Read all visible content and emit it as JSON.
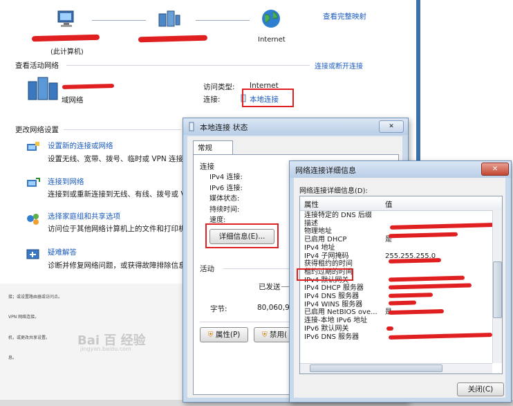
{
  "topbar": {
    "view_full_map": "查看完整映射",
    "this_computer": "(此计算机)",
    "internet_label": "Internet"
  },
  "active_networks": {
    "heading": "查看活动网络",
    "connect_disconnect": "连接或断开连接",
    "network_type": "域网络",
    "access_type_label": "访问类型:",
    "access_type_value": "Internet",
    "connection_label": "连接:",
    "connection_value": "本地连接"
  },
  "change_settings": {
    "heading": "更改网络设置",
    "items": [
      {
        "title": "设置新的连接或网络",
        "desc": "设置无线、宽带、拨号、临时或 VPN 连接"
      },
      {
        "title": "连接到网络",
        "desc": "连接到或重新连接到无线、有线、拨号或 V"
      },
      {
        "title": "选择家庭组和共享选项",
        "desc": "访问位于其他网络计算机上的文件和打印机"
      },
      {
        "title": "疑难解答",
        "desc": "诊断并修复网络问题，或获得故障排除信息"
      }
    ]
  },
  "left_small_text": [
    "接；或设置路由器或访问点。",
    "VPN 网络连接。",
    "机，或更改共享设置。",
    "息。"
  ],
  "watermark": {
    "line1": "Bai 百 经验",
    "line2": "jingyan.baidu.com"
  },
  "status_dialog": {
    "title": "本地连接 状态",
    "close_glyph": "✕",
    "tab": "常规",
    "connection_group": "连接",
    "rows": [
      "IPv4 连接:",
      "IPv6 连接:",
      "媒体状态:",
      "持续时间:",
      "速度:"
    ],
    "details_button": "详细信息(E)...",
    "activity_group": "活动",
    "sent_label": "已发送",
    "bytes_label": "字节:",
    "bytes_value": "80,060,9",
    "properties_button": "属性(P)",
    "disable_button": "禁用("
  },
  "details_dialog": {
    "title": "网络连接详细信息",
    "close_glyph": "✕",
    "subtitle": "网络连接详细信息(D):",
    "col_property": "属性",
    "col_value": "值",
    "rows": [
      {
        "property": "连接特定的 DNS 后缀",
        "value": ""
      },
      {
        "property": "描述",
        "value": ""
      },
      {
        "property": "物理地址",
        "value": ""
      },
      {
        "property": "已启用 DHCP",
        "value": "是"
      },
      {
        "property": "IPv4 地址",
        "value": ""
      },
      {
        "property": "IPv4 子网掩码",
        "value": "255.255.255.0"
      },
      {
        "property": "获得租约的时间",
        "value": ""
      },
      {
        "property": "租约过期的时间",
        "value": ""
      },
      {
        "property": "IPv4 默认网关",
        "value": ""
      },
      {
        "property": "IPv4 DHCP 服务器",
        "value": ""
      },
      {
        "property": "IPv4 DNS 服务器",
        "value": ""
      },
      {
        "property": "IPv4 WINS 服务器",
        "value": ""
      },
      {
        "property": "已启用 NetBIOS ove...",
        "value": "是"
      },
      {
        "property": "连接-本地 IPv6 地址",
        "value": ""
      },
      {
        "property": "IPv6 默认网关",
        "value": ""
      },
      {
        "property": "IPv6 DNS 服务器",
        "value": ""
      }
    ],
    "close_button": "关闭(C)"
  }
}
